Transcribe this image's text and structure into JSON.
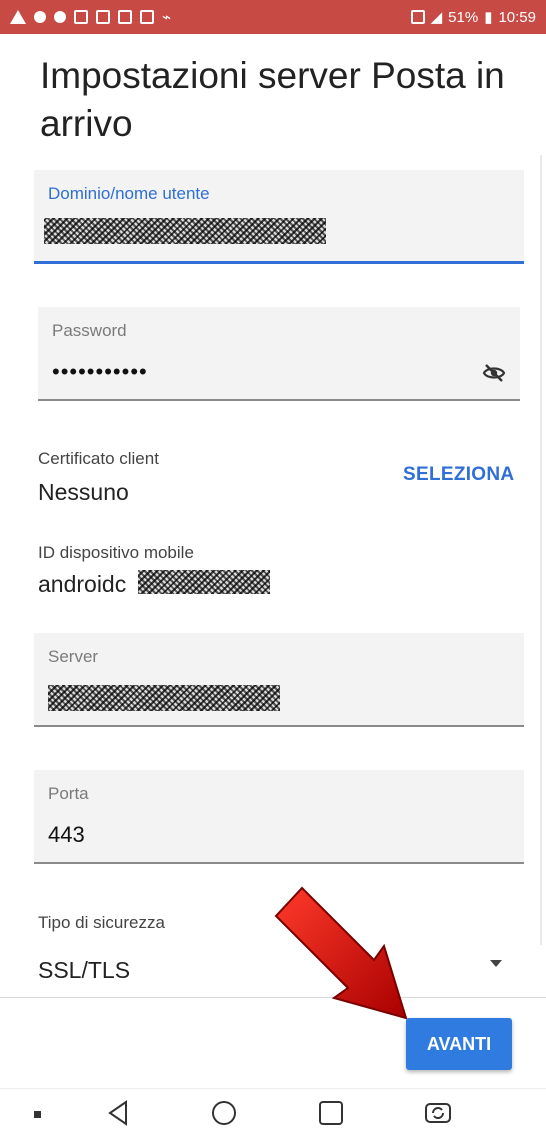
{
  "status_bar": {
    "battery": "51%",
    "time": "10:59"
  },
  "page": {
    "title": "Impostazioni server Posta in arrivo"
  },
  "fields": {
    "domain_user": {
      "label": "Dominio/nome utente"
    },
    "password": {
      "label": "Password",
      "value": "•••••••••••"
    },
    "server": {
      "label": "Server"
    },
    "port": {
      "label": "Porta",
      "value": "443"
    }
  },
  "client_certificate": {
    "label": "Certificato client",
    "value": "Nessuno",
    "action_label": "SELEZIONA"
  },
  "device_id": {
    "label": "ID dispositivo mobile",
    "value_prefix": "androidc"
  },
  "security": {
    "label": "Tipo di sicurezza",
    "value": "SSL/TLS"
  },
  "footer": {
    "next_label": "AVANTI"
  },
  "colors": {
    "status_bar": "#c84a45",
    "accent": "#2f6fd6",
    "button": "#2f7be0",
    "arrow": "#cc1010"
  },
  "icons": [
    "warning-icon",
    "shield-icon",
    "location-icon",
    "email-icon",
    "usb-icon",
    "nfc-icon",
    "signal-icon",
    "battery-icon",
    "visibility-off-icon",
    "back-icon",
    "home-icon",
    "recents-icon",
    "screen-rotate-icon"
  ]
}
